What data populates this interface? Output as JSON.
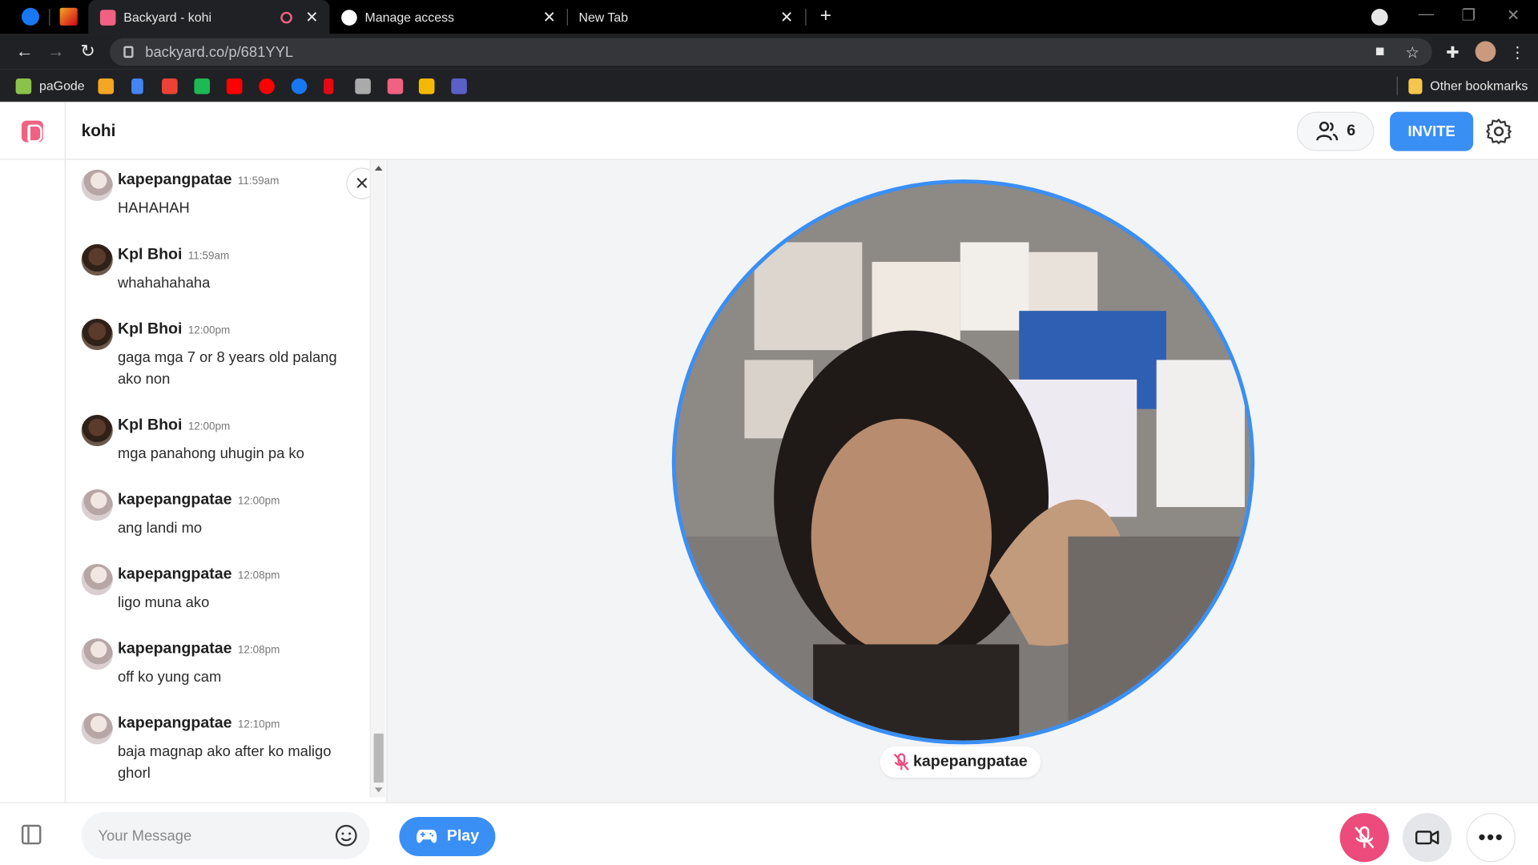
{
  "browser": {
    "tabs": [
      {
        "title": "Backyard - kohi",
        "active": true
      },
      {
        "title": "Manage access",
        "active": false
      },
      {
        "title": "New Tab",
        "active": false
      }
    ],
    "url": "backyard.co/p/681YYL",
    "bookmarks": [
      "paGode"
    ],
    "other_bookmarks": "Other bookmarks"
  },
  "app": {
    "room_title": "kohi",
    "member_count": "6",
    "invite_label": "INVITE"
  },
  "chat": {
    "messages": [
      {
        "author": "kapepangpatae",
        "time": "11:59am",
        "text": "HAHAHAH"
      },
      {
        "author": "Kpl Bhoi",
        "time": "11:59am",
        "text": "whahahahaha"
      },
      {
        "author": "Kpl Bhoi",
        "time": "12:00pm",
        "text": "gaga mga 7 or 8 years old palang ako non"
      },
      {
        "author": "Kpl Bhoi",
        "time": "12:00pm",
        "text": "mga panahong uhugin pa ko"
      },
      {
        "author": "kapepangpatae",
        "time": "12:00pm",
        "text": "ang landi mo"
      },
      {
        "author": "kapepangpatae",
        "time": "12:08pm",
        "text": "ligo muna ako"
      },
      {
        "author": "kapepangpatae",
        "time": "12:08pm",
        "text": "off ko yung cam"
      },
      {
        "author": "kapepangpatae",
        "time": "12:10pm",
        "text": "baja magnap ako after ko maligo ghorl"
      }
    ],
    "input_placeholder": "Your Message"
  },
  "stage": {
    "participant_name": "kapepangpatae",
    "muted": true
  },
  "footer": {
    "play_label": "Play"
  },
  "colors": {
    "accent": "#3a8ff5",
    "mic_muted": "#ec4b7b",
    "brand": "#f06182"
  }
}
